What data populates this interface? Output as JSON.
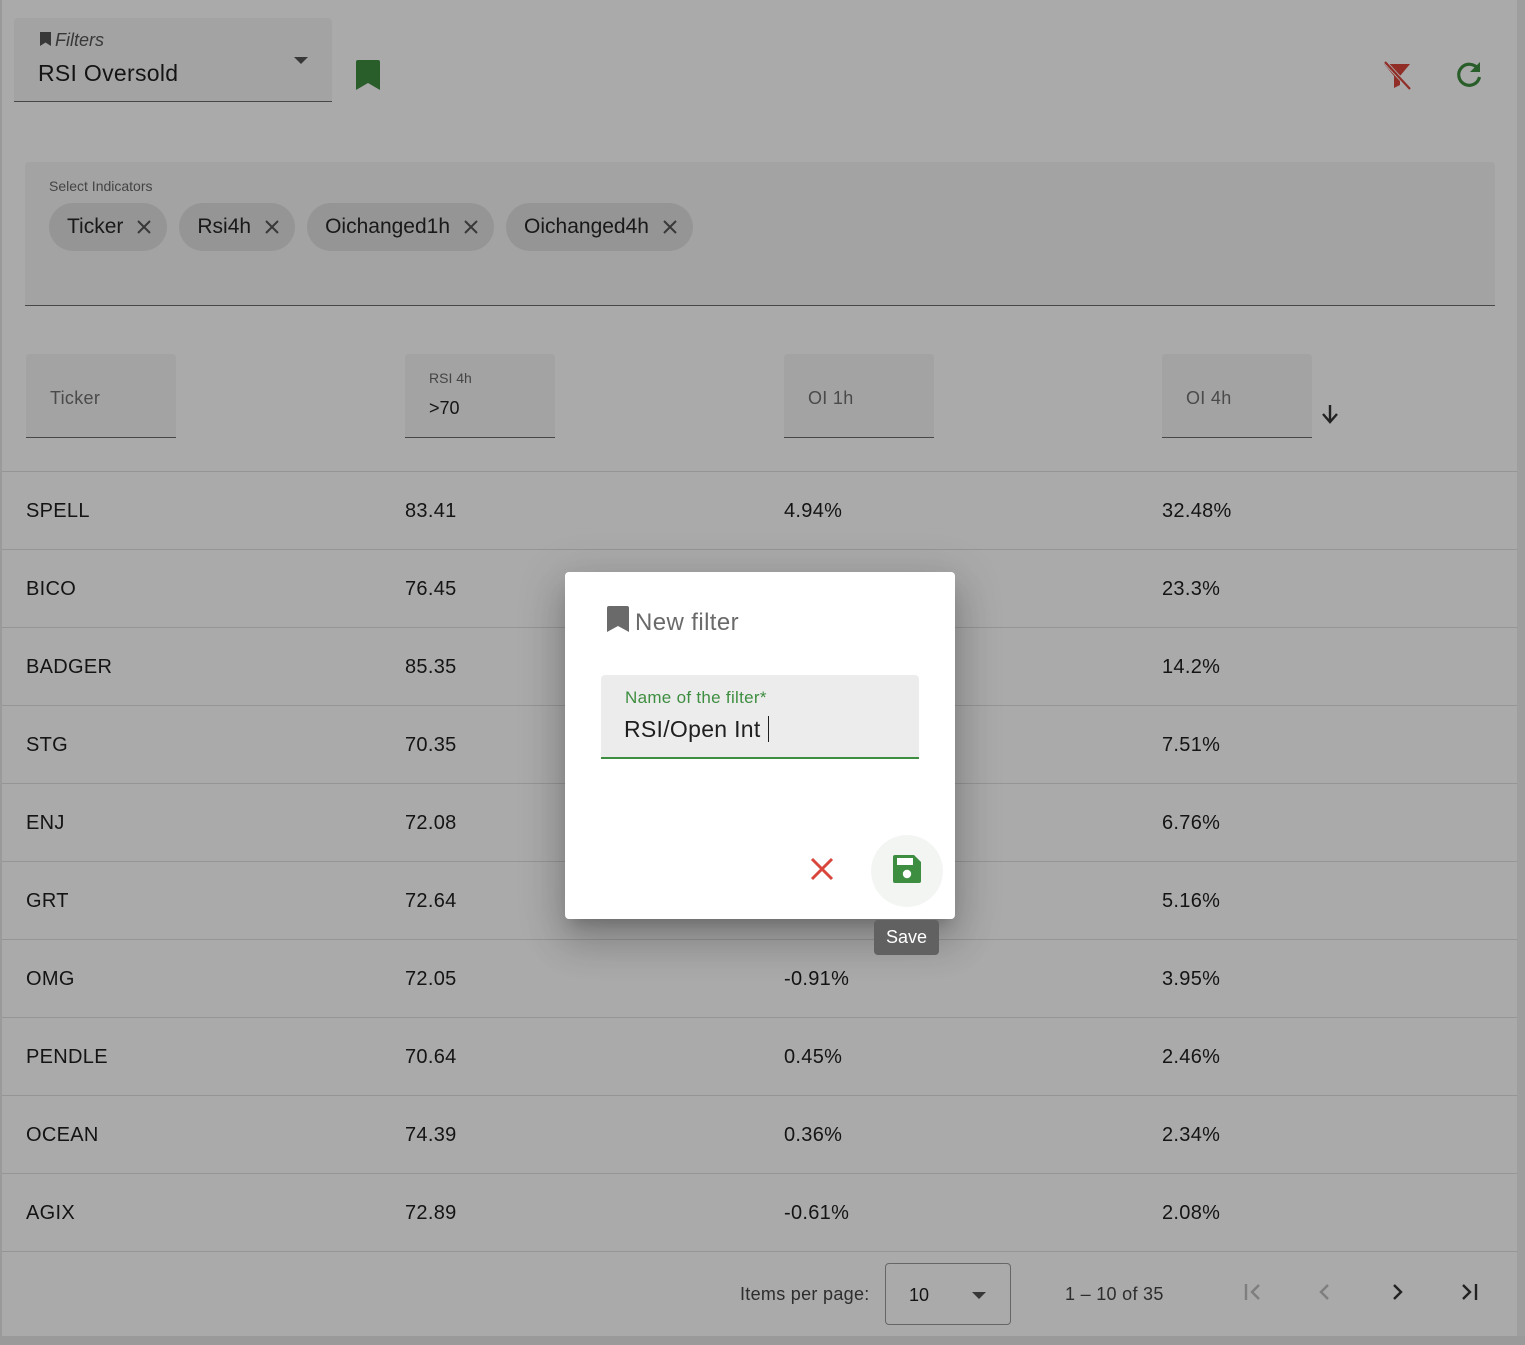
{
  "toolbar": {
    "filters_label": "Filters",
    "filters_value": "RSI Oversold"
  },
  "indicators": {
    "label": "Select Indicators",
    "chips": [
      "Ticker",
      "Rsi4h",
      "Oichanged1h",
      "Oichanged4h"
    ]
  },
  "columns": {
    "ticker": "Ticker",
    "rsi_label": "RSI 4h",
    "rsi_value": ">70",
    "oi1h": "OI 1h",
    "oi4h": "OI 4h"
  },
  "rows": [
    {
      "ticker": "SPELL",
      "rsi": "83.41",
      "oi1h": "4.94%",
      "oi4h": "32.48%"
    },
    {
      "ticker": "BICO",
      "rsi": "76.45",
      "oi1h": "",
      "oi4h": "23.3%"
    },
    {
      "ticker": "BADGER",
      "rsi": "85.35",
      "oi1h": "",
      "oi4h": "14.2%"
    },
    {
      "ticker": "STG",
      "rsi": "70.35",
      "oi1h": "",
      "oi4h": "7.51%"
    },
    {
      "ticker": "ENJ",
      "rsi": "72.08",
      "oi1h": "",
      "oi4h": "6.76%"
    },
    {
      "ticker": "GRT",
      "rsi": "72.64",
      "oi1h": "",
      "oi4h": "5.16%"
    },
    {
      "ticker": "OMG",
      "rsi": "72.05",
      "oi1h": "-0.91%",
      "oi4h": "3.95%"
    },
    {
      "ticker": "PENDLE",
      "rsi": "70.64",
      "oi1h": "0.45%",
      "oi4h": "2.46%"
    },
    {
      "ticker": "OCEAN",
      "rsi": "74.39",
      "oi1h": "0.36%",
      "oi4h": "2.34%"
    },
    {
      "ticker": "AGIX",
      "rsi": "72.89",
      "oi1h": "-0.61%",
      "oi4h": "2.08%"
    }
  ],
  "paginator": {
    "items_label": "Items per page:",
    "page_size": "10",
    "range": "1 – 10 of 35"
  },
  "dialog": {
    "title": "New filter",
    "field_label": "Name of the filter*",
    "field_value": "RSI/Open Int",
    "save_tooltip": "Save"
  },
  "colors": {
    "accent_green": "#3e8e41",
    "danger_red": "#d9463b"
  },
  "icons": [
    "bookmark-icon",
    "filter-off-icon",
    "refresh-icon",
    "close-icon",
    "arrow-down-icon",
    "first-page-icon",
    "chevron-left-icon",
    "chevron-right-icon",
    "last-page-icon",
    "save-icon"
  ]
}
